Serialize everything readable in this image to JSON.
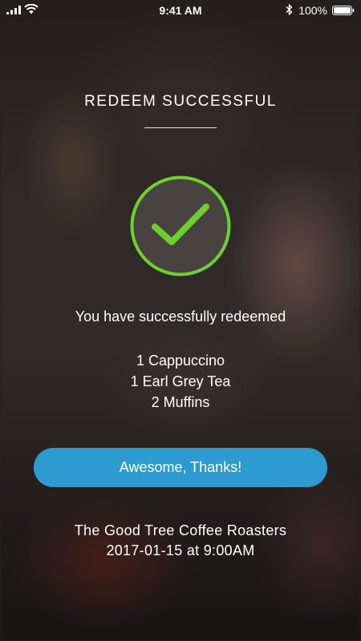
{
  "status_bar": {
    "time": "9:41 AM",
    "battery_percent": "100%",
    "battery_level": 1.0,
    "signal_icon": "signal-bars-icon",
    "wifi_icon": "wifi-icon",
    "bluetooth_icon": "bluetooth-icon",
    "battery_icon": "battery-icon"
  },
  "header": {
    "title": "REDEEM SUCCESSFUL"
  },
  "success": {
    "icon": "checkmark-circle-icon",
    "accent_color": "#6fcf2f",
    "message": "You have successfully redeemed"
  },
  "items": [
    "1 Cappuccino",
    "1 Earl Grey Tea",
    "2 Muffins"
  ],
  "actions": {
    "confirm_label": "Awesome, Thanks!",
    "button_color": "#2e9bd0"
  },
  "footer": {
    "store_name": "The Good Tree Coffee Roasters",
    "datetime": "2017-01-15 at 9:00AM"
  }
}
